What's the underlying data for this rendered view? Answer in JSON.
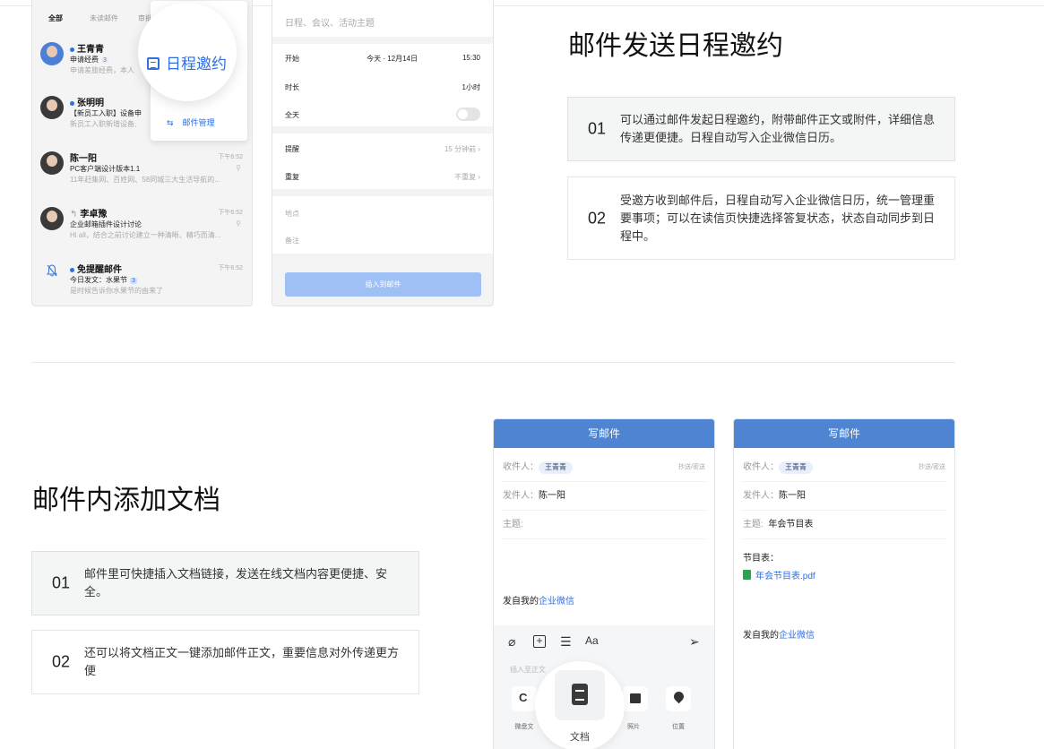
{
  "mail_list": {
    "tabs": [
      "全部",
      "未读邮件",
      "审批"
    ],
    "items": [
      {
        "name": "王青青",
        "subject": "申请经费",
        "badge": "3",
        "preview": "申请差旅经费，本人",
        "unread": true,
        "time": "",
        "reply": ""
      },
      {
        "name": "张明明",
        "subject": "【新员工入职】设备申",
        "badge": "",
        "preview": "新员工入职新增设备,",
        "unread": true,
        "time": "",
        "reply": ""
      },
      {
        "name": "陈一阳",
        "subject": "PC客户端设计版本1.1",
        "badge": "",
        "preview": "11年赶集网、百姓网、58同城三大生活导航的...",
        "unread": false,
        "time": "下午6:52",
        "reply": ""
      },
      {
        "name": "李卓豫",
        "subject": "企业邮箱插件设计讨论",
        "badge": "",
        "preview": "Hi all，结合之前讨论建立一种清晰、精巧而清...",
        "unread": false,
        "time": "下午6:52",
        "reply": "↰"
      },
      {
        "name": "免提醒邮件",
        "subject": "今日发文：水果节",
        "badge": "3",
        "preview": "是时候告诉你水果节的由来了",
        "unread": true,
        "time": "下午6:52",
        "reply": ""
      }
    ],
    "popup_schedule": "日程邀约",
    "popup_manage": "邮件管理"
  },
  "schedule_form": {
    "title_placeholder": "日程、会议、活动主题",
    "start_label": "开始",
    "start_date": "今天 · 12月14日",
    "start_time": "15:30",
    "duration_label": "时长",
    "duration_value": "1小时",
    "allday_label": "全天",
    "remind_label": "提醒",
    "remind_value": "15 分钟前 ›",
    "repeat_label": "重复",
    "repeat_value": "不重复 ›",
    "location_placeholder": "地点",
    "note_placeholder": "备注",
    "insert_button": "插入到邮件"
  },
  "section1": {
    "heading": "邮件发送日程邀约",
    "features": [
      {
        "num": "01",
        "desc": "可以通过邮件发起日程邀约，附带邮件正文或附件，详细信息传递更便捷。日程自动写入企业微信日历。"
      },
      {
        "num": "02",
        "desc": "受邀方收到邮件后，日程自动写入企业微信日历，统一管理重要事项；可以在读信页快捷选择答复状态，状态自动同步到日程中。"
      }
    ]
  },
  "section2": {
    "heading": "邮件内添加文档",
    "features": [
      {
        "num": "01",
        "desc": "邮件里可快捷插入文档链接，发送在线文档内容更便捷、安全。"
      },
      {
        "num": "02",
        "desc": "还可以将文档正文一键添加邮件正文，重要信息对外传递更方便"
      }
    ]
  },
  "compose1": {
    "title": "写邮件",
    "to_label": "收件人：",
    "to_value": "王青青",
    "cc": "抄送/密送",
    "from_label": "发件人：",
    "from_value": "陈一阳",
    "subject_label": "主题:",
    "signature_prefix": "发自我的",
    "signature_link": "企业微信",
    "toolbar_hint": "插入至正文",
    "tiles": [
      "微盘文",
      "文档",
      "照片",
      "位置"
    ]
  },
  "compose2": {
    "title": "写邮件",
    "to_label": "收件人：",
    "to_value": "王青青",
    "cc": "抄送/密送",
    "from_label": "发件人：",
    "from_value": "陈一阳",
    "subject_label": "主题:",
    "subject_value": "年会节目表",
    "body_title": "节目表：",
    "attachment": "年会节目表.pdf",
    "signature_prefix": "发自我的",
    "signature_link": "企业微信"
  },
  "colors": {
    "accent": "#2f6fde",
    "header_blue": "#4f84d2"
  }
}
